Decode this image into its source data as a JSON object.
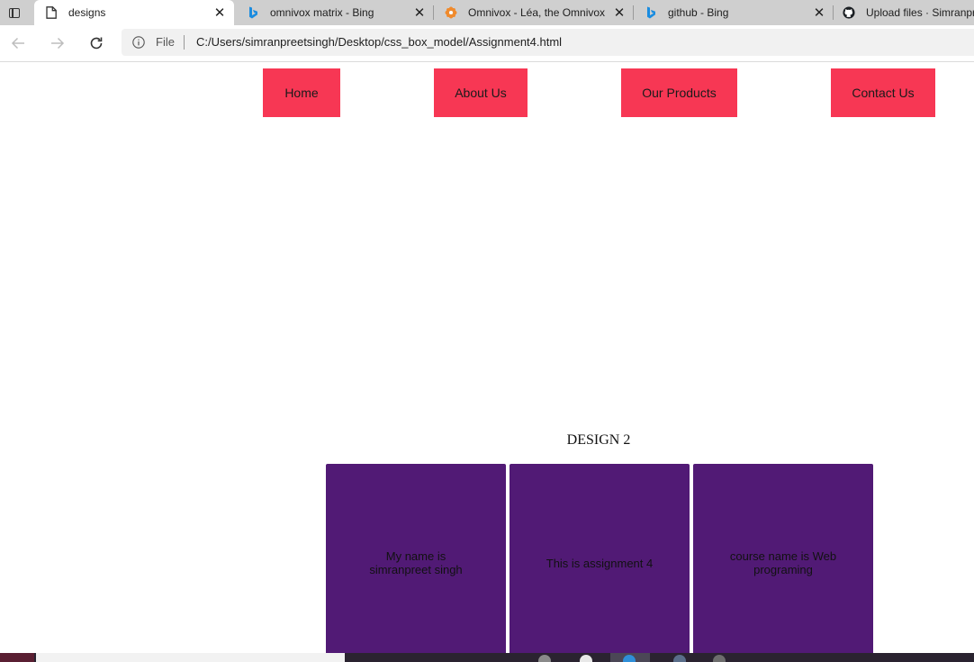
{
  "browser": {
    "tabs": [
      {
        "title": "designs",
        "favicon": "page-icon",
        "active": true
      },
      {
        "title": "omnivox matrix - Bing",
        "favicon": "bing-icon",
        "active": false
      },
      {
        "title": "Omnivox - Léa, the Omnivox",
        "favicon": "omnivox-icon",
        "active": false
      },
      {
        "title": "github - Bing",
        "favicon": "bing-icon",
        "active": false
      },
      {
        "title": "Upload files · Simranpr",
        "favicon": "github-icon",
        "active": false
      }
    ],
    "address": {
      "scheme_label": "File",
      "url": "C:/Users/simranpreetsingh/Desktop/css_box_model/Assignment4.html"
    }
  },
  "page": {
    "nav": [
      "Home",
      "About Us",
      "Our Products",
      "Contact Us"
    ],
    "design_heading": "DESIGN 2",
    "boxes": [
      "My name is simranpreet singh",
      "This is assignment 4",
      "course name is Web programing"
    ]
  },
  "colors": {
    "nav_button": "#f73754",
    "box": "#511a75",
    "tab_strip": "#cfcfcf"
  }
}
